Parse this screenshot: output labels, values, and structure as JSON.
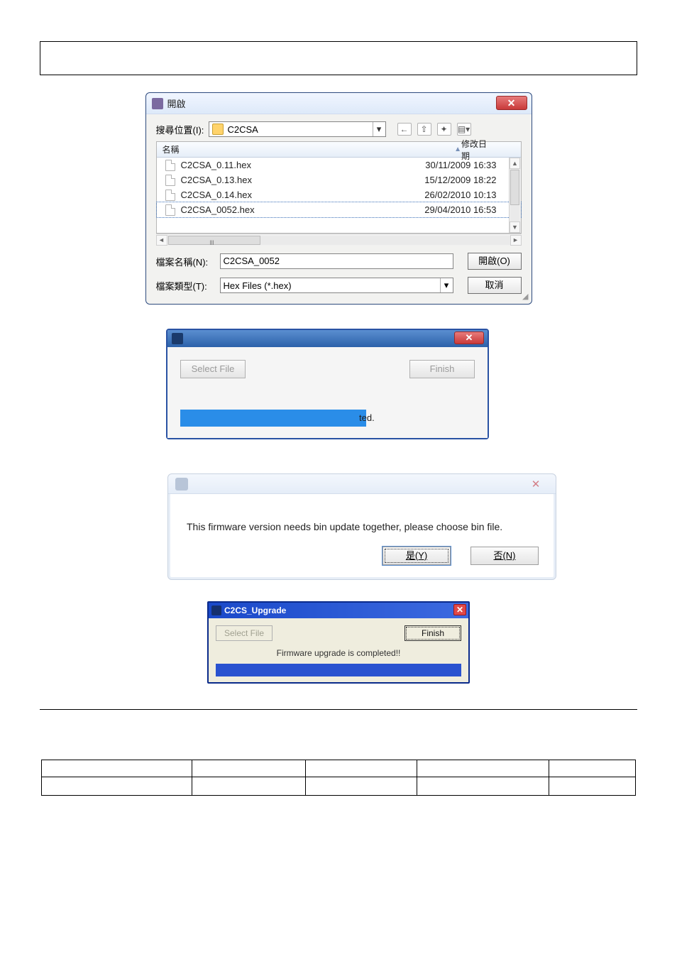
{
  "dlg1": {
    "title": "開啟",
    "look_in_label": "搜尋位置(I):",
    "folder_name": "C2CSA",
    "name_col": "名稱",
    "date_col": "修改日期",
    "files": [
      {
        "name": "C2CSA_0.11.hex",
        "date": "30/11/2009 16:33",
        "selected": false
      },
      {
        "name": "C2CSA_0.13.hex",
        "date": "15/12/2009 18:22",
        "selected": false
      },
      {
        "name": "C2CSA_0.14.hex",
        "date": "26/02/2010 10:13",
        "selected": false
      },
      {
        "name": "C2CSA_0052.hex",
        "date": "29/04/2010 16:53",
        "selected": true
      }
    ],
    "file_name_label": "檔案名稱(N):",
    "file_name_value": "C2CSA_0052",
    "file_type_label": "檔案類型(T):",
    "file_type_value": "Hex Files (*.hex)",
    "open_btn": "開啟(O)",
    "cancel_btn": "取消",
    "close": "✕",
    "nav": {
      "back": "←",
      "up": "⇧",
      "new": "✦",
      "list": "▤",
      "menu": "▾"
    }
  },
  "dlg2": {
    "select_file_btn": "Select File",
    "finish_btn": "Finish",
    "progress_text_suffix": "ted.",
    "close": "✕"
  },
  "dlg3": {
    "message": "This firmware version needs bin update together, please choose bin file.",
    "yes_btn": "是(Y)",
    "no_btn": "否(N)",
    "close": "✕"
  },
  "dlg4": {
    "title": "C2CS_Upgrade",
    "select_file_btn": "Select File",
    "finish_btn": "Finish",
    "message": "Firmware upgrade is completed!!",
    "close": "✕"
  }
}
